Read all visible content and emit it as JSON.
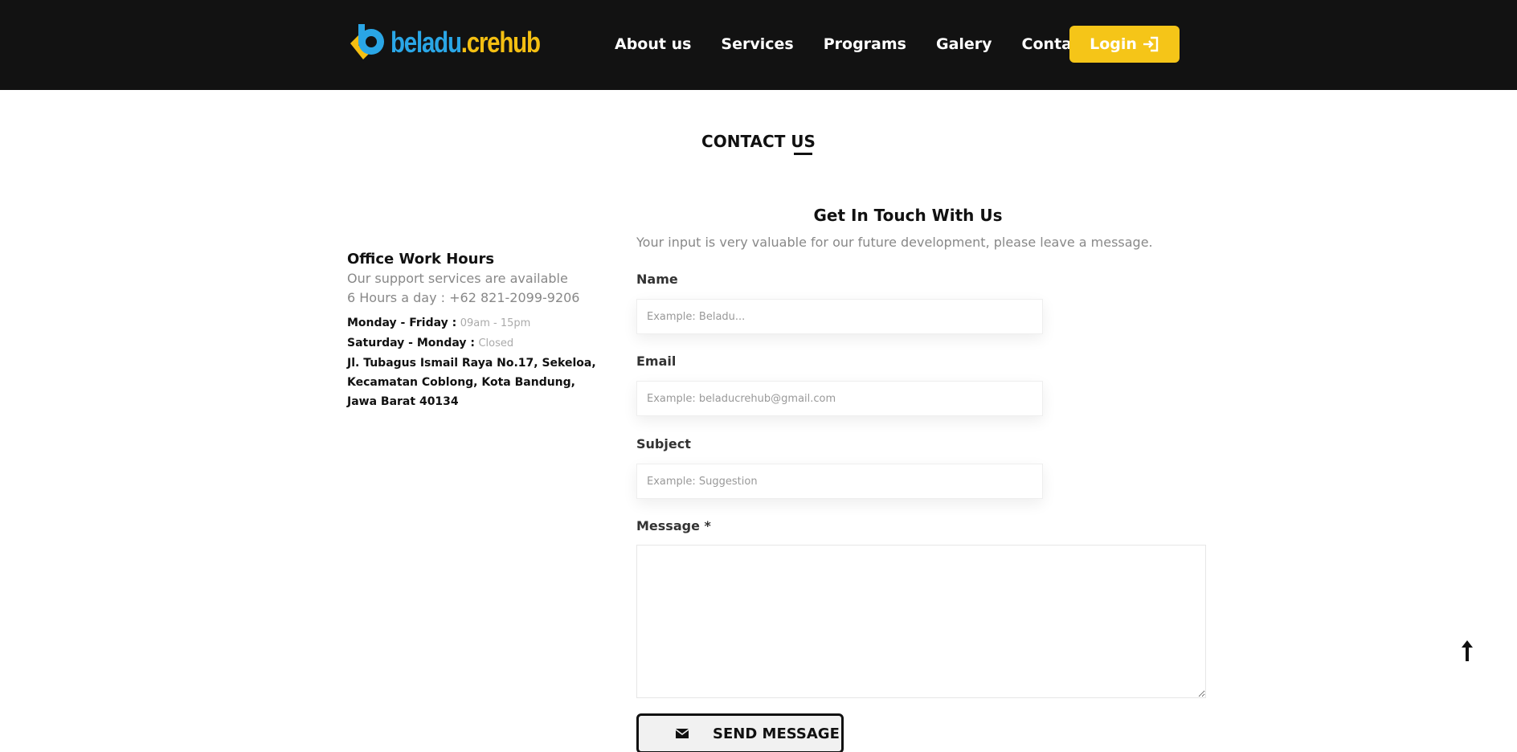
{
  "logo": {
    "text_a": "beladu",
    "text_b": ".crehub",
    "color_a": "#2aa6e6",
    "color_b": "#f4bf12"
  },
  "nav": {
    "links": [
      "About us",
      "Services",
      "Programs",
      "Galery",
      "Contact Us"
    ],
    "active": "Contact Us",
    "login_label": "Login",
    "login_icon": "login-icon",
    "accent": "#f5c518"
  },
  "page": {
    "title": "CONTACT US"
  },
  "office": {
    "title": "Office Work Hours",
    "line1": "Our support services are available",
    "line2": "6 Hours a day : +62 821-2099-9206",
    "hours": [
      {
        "day": "Monday - Friday :",
        "value": "09am - 15pm"
      },
      {
        "day": "Saturday - Monday :",
        "value": "Closed"
      }
    ],
    "address": "Jl. Tubagus Ismail Raya No.17, Sekeloa, Kecamatan Coblong, Kota Bandung, Jawa Barat 40134"
  },
  "form": {
    "title": "Get In Touch With Us",
    "subtitle": "Your input is very valuable for our future development, please leave a message.",
    "name_label": "Name",
    "name_placeholder": "Example: Beladu...",
    "email_label": "Email",
    "email_placeholder": "Example: beladucrehub@gmail.com",
    "subject_label": "Subject",
    "subject_placeholder": "Example: Suggestion",
    "message_label": "Message *",
    "message_value": "",
    "send_label": "SEND MESSAGE",
    "send_icon": "envelope-icon"
  },
  "scroll_top_icon": "arrow-up-icon"
}
